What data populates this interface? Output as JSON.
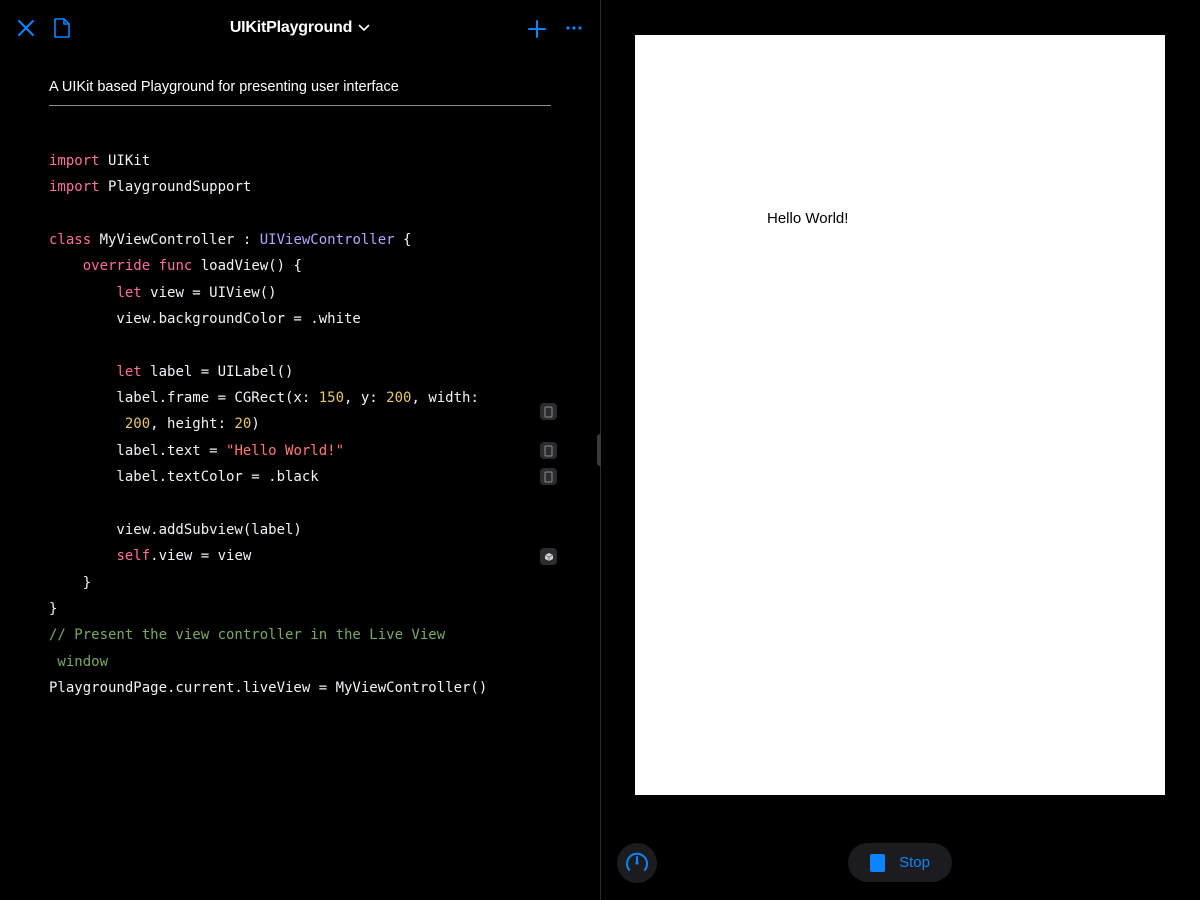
{
  "header": {
    "title": "UIKitPlayground",
    "accent_color": "#0a84ff",
    "icons": [
      "close-icon",
      "document-icon",
      "chevron-down-icon",
      "plus-icon",
      "ellipsis-icon"
    ]
  },
  "editor": {
    "description": "A UIKit based Playground for presenting user interface",
    "code_lines": [
      "import UIKit",
      "import PlaygroundSupport",
      "",
      "class MyViewController : UIViewController {",
      "    override func loadView() {",
      "        let view = UIView()",
      "        view.backgroundColor = .white",
      "",
      "        let label = UILabel()",
      "        label.frame = CGRect(x: 150, y: 200, width:",
      "         200, height: 20)",
      "        label.text = \"Hello World!\"",
      "        label.textColor = .black",
      "",
      "        view.addSubview(label)",
      "        self.view = view",
      "    }",
      "}",
      "// Present the view controller in the Live View",
      " window",
      "PlaygroundPage.current.liveView = MyViewController()"
    ],
    "syntax_colors": {
      "keyword": "#ff6e9c",
      "type": "#b6a4ff",
      "number": "#e6c66a",
      "string": "#ff7a6b",
      "comment": "#7aa862",
      "plain": "#f2f2f7"
    },
    "result_badges": [
      "result-indicator-icon",
      "result-indicator-icon",
      "result-indicator-icon",
      "view-result-icon"
    ]
  },
  "live_view": {
    "label_text": "Hello World!",
    "background": "#ffffff",
    "controls": {
      "stop_label": "Stop",
      "speed_icon": "speedometer-icon",
      "stop_icon": "stop-square-icon"
    }
  }
}
